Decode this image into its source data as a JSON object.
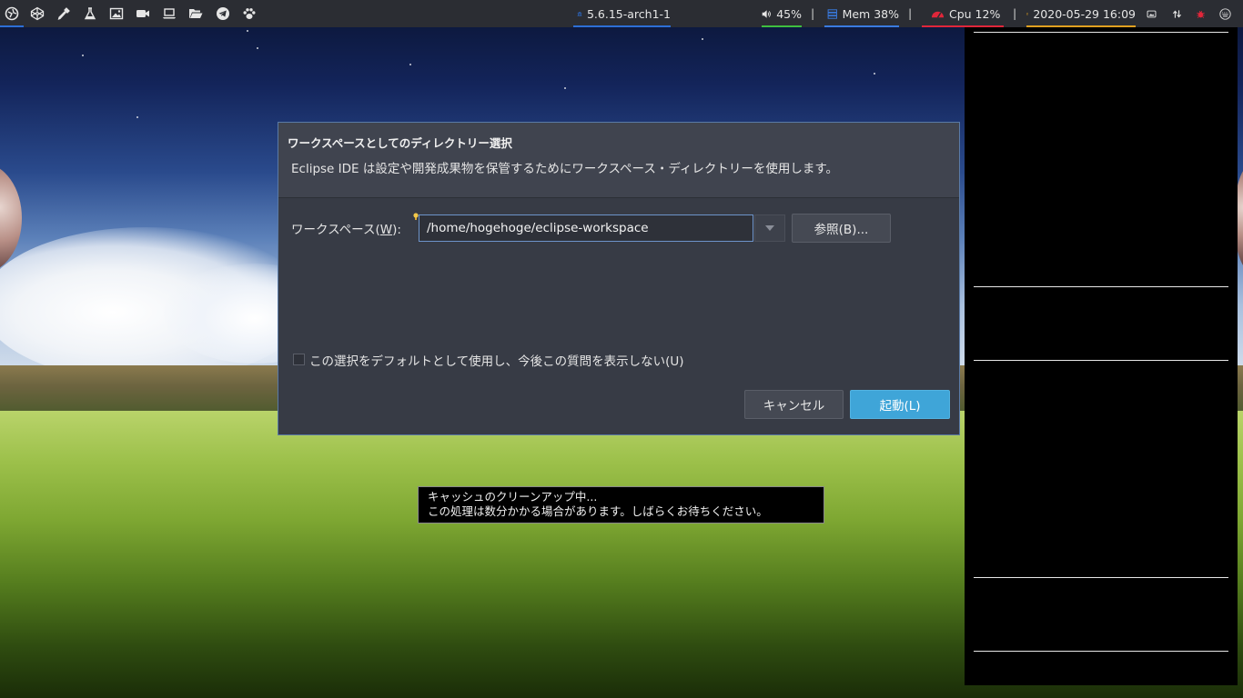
{
  "panel": {
    "launchers": [
      {
        "icon": "browser-icon"
      },
      {
        "icon": "codepen-icon"
      },
      {
        "icon": "eyedropper-icon"
      },
      {
        "icon": "flask-icon"
      },
      {
        "icon": "image-icon"
      },
      {
        "icon": "video-camera-icon"
      },
      {
        "icon": "laptop-icon"
      },
      {
        "icon": "folder-open-icon"
      },
      {
        "icon": "telegram-icon"
      },
      {
        "icon": "paw-icon"
      }
    ],
    "kernel": "5.6.15-arch1-1",
    "volume": "45%",
    "memory": "Mem 38%",
    "cpu": "Cpu  12%",
    "datetime": "2020-05-29 16:09",
    "separator": "|",
    "colors": {
      "background": "#2b2d33",
      "kernel": "#2d6fd6",
      "volume": "#3fbf3f",
      "memory": "#3a7be0",
      "cpu": "#e0263a",
      "datetime": "#e0a020"
    }
  },
  "dialog": {
    "title": "ワークスペースとしてのディレクトリー選択",
    "message": "Eclipse IDE は設定や開発成果物を保管するためにワークスペース・ディレクトリーを使用します。",
    "workspace_label_prefix": "ワークスペース(",
    "workspace_label_mnemonic": "W",
    "workspace_label_suffix": "):",
    "workspace_value": "/home/hogehoge/eclipse-workspace",
    "browse_label": "参照(B)...",
    "default_checkbox_label": "この選択をデフォルトとして使用し、今後この質問を表示しない(U)",
    "default_checked": false,
    "cancel_label": "キャンセル",
    "launch_label": "起動(L)",
    "accent_color": "#3fa5d8"
  },
  "notification": {
    "line1": "キャッシュのクリーンアップ中...",
    "line2": "この処理は数分かかる場合があります。しばらくお待ちください。"
  }
}
